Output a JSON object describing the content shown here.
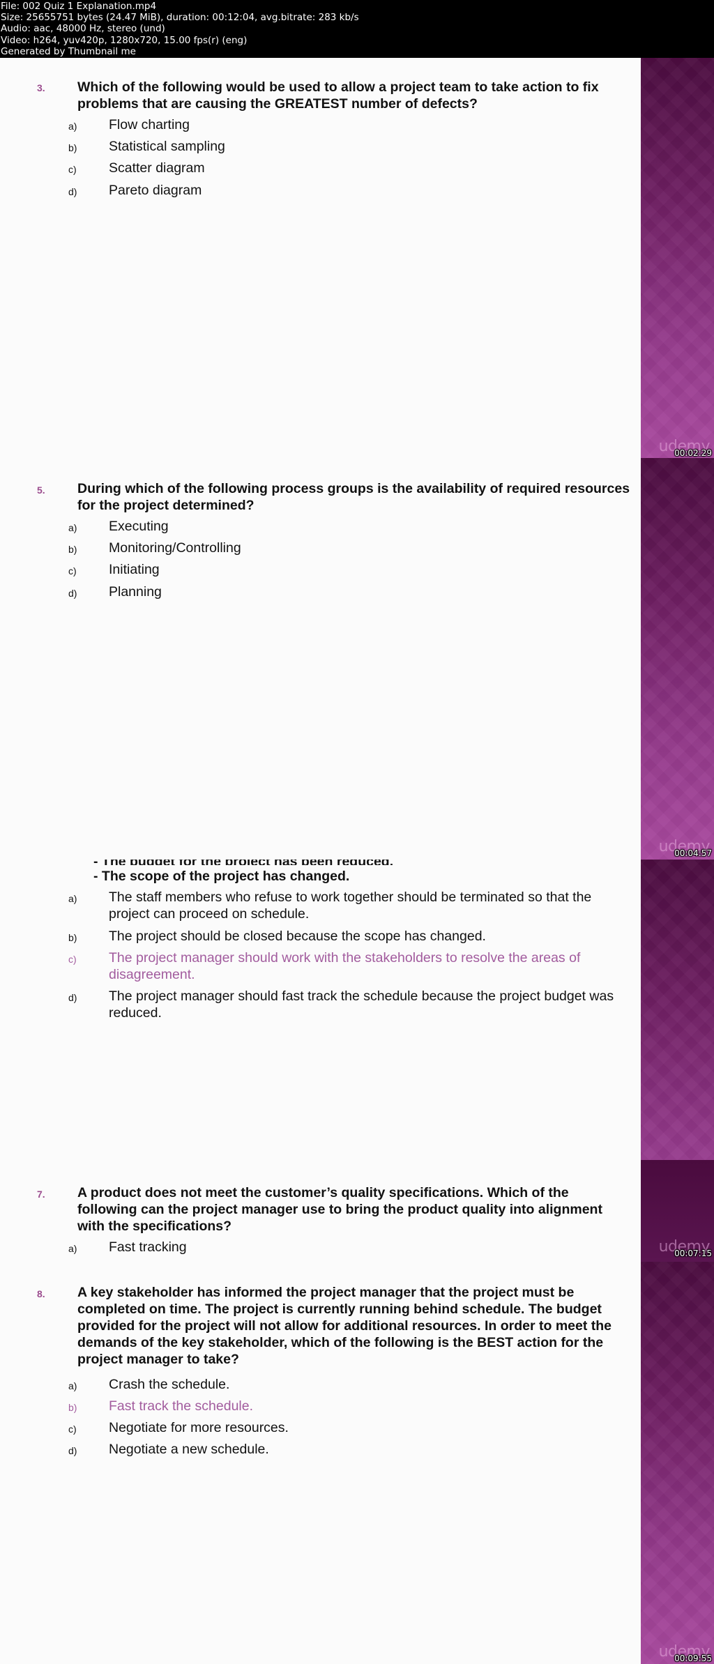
{
  "header": {
    "lines": [
      "File: 002 Quiz 1 Explanation.mp4",
      "Size: 25655751 bytes (24.47 MiB), duration: 00:12:04, avg.bitrate: 283 kb/s",
      "Audio: aac, 48000 Hz, stereo (und)",
      "Video: h264, yuv420p, 1280x720, 15.00 fps(r) (eng)",
      "Generated by Thumbnail me"
    ]
  },
  "colors": {
    "accent": "#9b4c8e",
    "correct_answer": "#a25c9e",
    "side_panel_top": "#4b0c3f",
    "side_panel_bottom": "#a9499f"
  },
  "frames": [
    {
      "timestamp": "00:02:29",
      "watermark": "udemy",
      "question": {
        "number": "3.",
        "text": "Which of the following would be used to allow a project team to take action to fix problems that are causing the GREATEST number of defects?",
        "options": [
          {
            "letter": "a)",
            "text": "Flow charting"
          },
          {
            "letter": "b)",
            "text": "Statistical sampling"
          },
          {
            "letter": "c)",
            "text": "Scatter diagram"
          },
          {
            "letter": "d)",
            "text": "Pareto diagram"
          }
        ]
      }
    },
    {
      "timestamp": "00:04:57",
      "watermark": "udemy",
      "question": {
        "number": "5.",
        "text": "During which of the following process groups is the availability of required resources for the project determined?",
        "options": [
          {
            "letter": "a)",
            "text": "Executing"
          },
          {
            "letter": "b)",
            "text": "Monitoring/Controlling"
          },
          {
            "letter": "c)",
            "text": "Initiating"
          },
          {
            "letter": "d)",
            "text": "Planning"
          }
        ]
      }
    },
    {
      "timestamp": "00:07:15",
      "watermark": "udemy",
      "partial_question": {
        "bullets": [
          "- The budget for the project has been reduced.",
          "- The scope of the project has changed."
        ],
        "options": [
          {
            "letter": "a)",
            "text": "The staff members who refuse to work together should be terminated so that the project can proceed on schedule."
          },
          {
            "letter": "b)",
            "text": "The project should be closed because the scope has changed."
          },
          {
            "letter": "c)",
            "text": "The project manager should work with the stakeholders to resolve the areas of disagreement.",
            "correct": true
          },
          {
            "letter": "d)",
            "text": "The project manager should fast track the schedule because the project budget was reduced."
          }
        ]
      },
      "question": {
        "number": "7.",
        "text": "A product does not meet the customer’s quality specifications. Which of the following can the project manager use to bring the product quality into alignment with the specifications?",
        "options": [
          {
            "letter": "a)",
            "text": "Fast tracking"
          }
        ]
      }
    },
    {
      "timestamp": "00:09:55",
      "watermark": "udemy",
      "question": {
        "number": "8.",
        "text": "A key stakeholder has informed the project manager that the project must be completed on time. The project is currently running behind schedule. The budget provided for the project will not allow for additional resources. In order to meet the demands of the key stakeholder, which of the following is the BEST action for the project manager to take?",
        "options": [
          {
            "letter": "a)",
            "text": "Crash the schedule."
          },
          {
            "letter": "b)",
            "text": "Fast track the schedule.",
            "correct": true
          },
          {
            "letter": "c)",
            "text": "Negotiate for more resources."
          },
          {
            "letter": "d)",
            "text": "Negotiate a new schedule."
          }
        ]
      }
    }
  ]
}
